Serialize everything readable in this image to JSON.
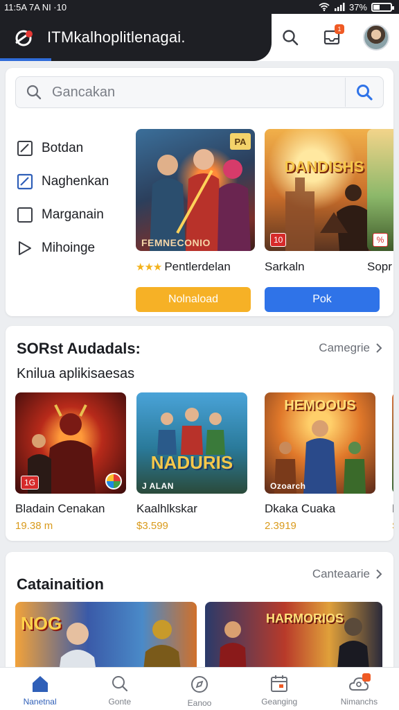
{
  "status_bar": {
    "time": "11:5A 7A NI ·10",
    "battery": "37%",
    "battery_level": 0.37
  },
  "app_bar": {
    "title": "ITMkalhoplitlenagai.",
    "notification_count": "1"
  },
  "search": {
    "placeholder": "Gancakan"
  },
  "filters": [
    {
      "label": "Botdan",
      "icon": "square-check-icon"
    },
    {
      "label": "Naghenkan",
      "icon": "square-check-blue-icon"
    },
    {
      "label": "Marganain",
      "icon": "square-outline-icon"
    },
    {
      "label": "Mihoinge",
      "icon": "play-outline-icon"
    }
  ],
  "featured": [
    {
      "name": "Pentlerdelan",
      "rating_stars": "★★★",
      "button": "Nolnaload",
      "button_color": "#f6b126",
      "badge": "PA",
      "caption": "FEMNECONIO"
    },
    {
      "name": "Sarkaln",
      "button": "Pok",
      "button_color": "#2f73e8",
      "badge": "10",
      "art_title": "DANDISHS"
    },
    {
      "name": "Sopr",
      "badge": "%"
    }
  ],
  "section_popular": {
    "title": "SORst Audadals:",
    "link": "Camegrie",
    "subtitle": "Knilua aplikisaesas",
    "games": [
      {
        "name": "Bladain Cenakan",
        "price": "19.38 m",
        "badge": "1G"
      },
      {
        "name": "Kaalhlkskar",
        "price": "$3.599",
        "caption": "J ALAN",
        "art_title": "NADURIS"
      },
      {
        "name": "Dkaka Cuaka",
        "price": "2.3919",
        "caption": "Ozoarch",
        "art_title": "HEMOOUS"
      },
      {
        "name": "K",
        "price": "S"
      }
    ]
  },
  "section_catalog": {
    "title": "Catainaition",
    "link": "Canteaarie",
    "tiles": [
      {
        "art_title": "NOG"
      },
      {
        "art_title": "HARMORIOS"
      }
    ]
  },
  "bottom_nav": [
    {
      "label": "Nanetnal",
      "icon": "home-icon",
      "active": true
    },
    {
      "label": "Gonte",
      "icon": "search-icon"
    },
    {
      "label": "Eanoo",
      "icon": "compass-icon"
    },
    {
      "label": "Geanging",
      "icon": "calendar-icon"
    },
    {
      "label": "Nimanchs",
      "icon": "cloud-user-icon",
      "badge": true
    }
  ],
  "colors": {
    "accent": "#2f73e8",
    "price": "#d99a1b",
    "dark_header": "#1e1f24",
    "notification": "#ef5a24"
  }
}
